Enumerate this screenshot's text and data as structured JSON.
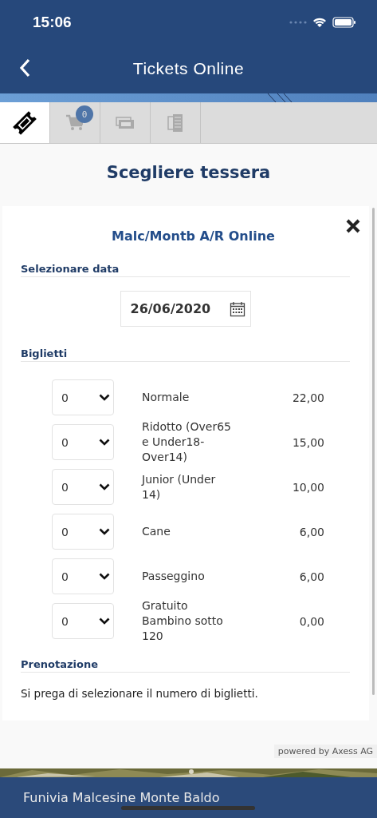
{
  "status_bar": {
    "time": "15:06"
  },
  "nav": {
    "title": "Tickets Online"
  },
  "tabs": [
    {
      "kind": "ticket",
      "selected": true
    },
    {
      "kind": "cart",
      "selected": false,
      "badge": "0"
    },
    {
      "kind": "cards",
      "selected": false
    },
    {
      "kind": "receipt",
      "selected": false
    }
  ],
  "page_title": "Scegliere tessera",
  "card": {
    "title": "Malc/Montb A/R Online",
    "date_section": "Selezionare data",
    "date": "26/06/2020",
    "tickets_section": "Biglietti",
    "tickets": [
      {
        "quantity": "0",
        "name": "Normale",
        "price": "22,00"
      },
      {
        "quantity": "0",
        "name": "Ridotto (Over65 e Under18-Over14)",
        "price": "15,00"
      },
      {
        "quantity": "0",
        "name": "Junior (Under 14)",
        "price": "10,00"
      },
      {
        "quantity": "0",
        "name": "Cane",
        "price": "6,00"
      },
      {
        "quantity": "0",
        "name": "Passeggino",
        "price": "6,00"
      },
      {
        "quantity": "0",
        "name": "Gratuito Bambino sotto 120",
        "price": "0,00"
      }
    ],
    "booking_section": "Prenotazione",
    "message": "Si prega di selezionare il numero di biglietti."
  },
  "powered_by": "powered by Axess AG",
  "footer": {
    "company": "Funivia Malcesine Monte Baldo"
  }
}
